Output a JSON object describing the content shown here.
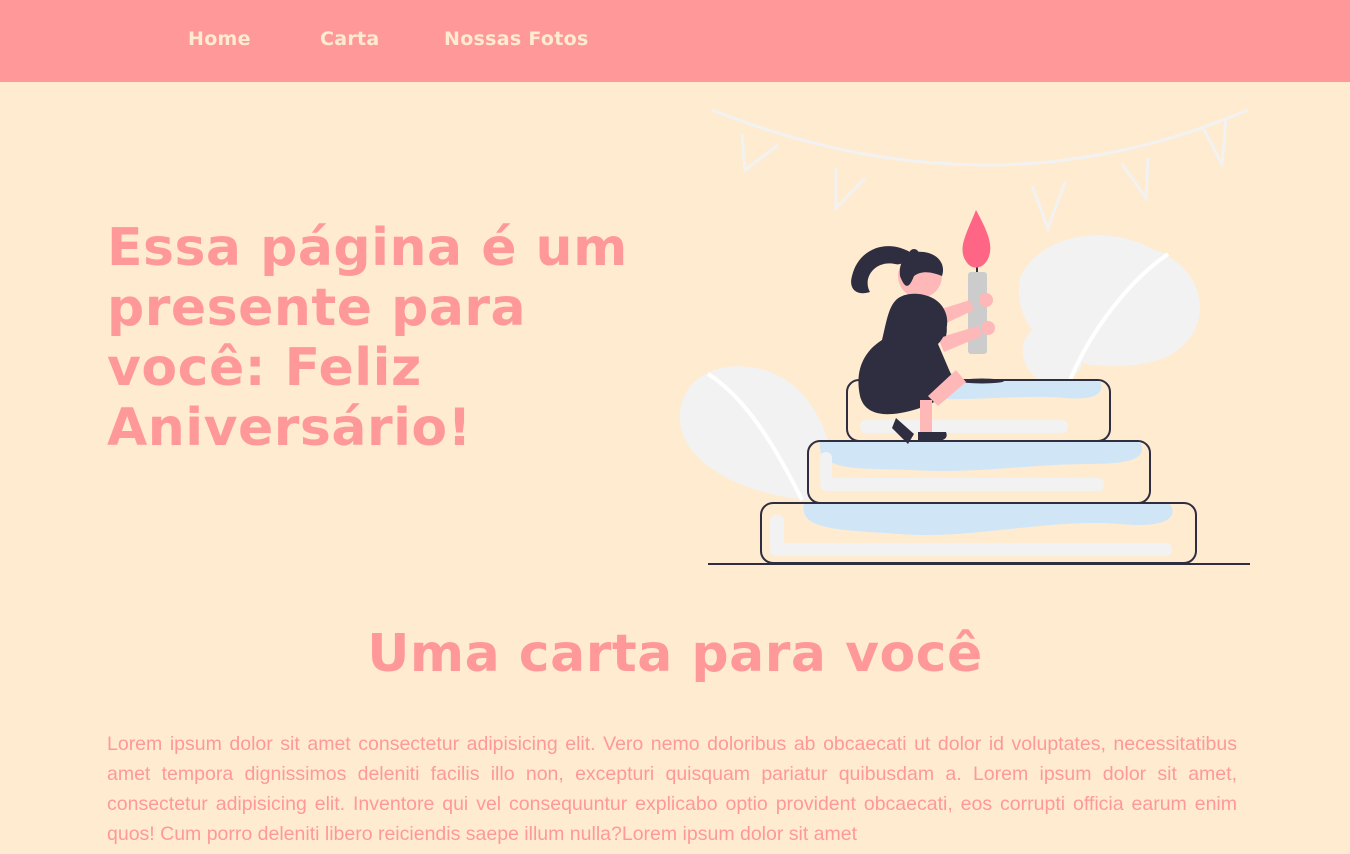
{
  "nav": {
    "home": "Home",
    "carta": "Carta",
    "fotos": "Nossas Fotos"
  },
  "hero": {
    "title": "Essa página é um presente para você: Feliz Aniversário!"
  },
  "letter": {
    "title": "Uma carta para você",
    "body": "Lorem ipsum dolor sit amet consectetur adipisicing elit. Vero nemo doloribus ab obcaecati ut dolor id voluptates, necessitatibus amet tempora dignissimos deleniti facilis illo non, excepturi quisquam pariatur quibusdam a. Lorem ipsum dolor sit amet, consectetur adipisicing elit. Inventore qui vel consequuntur explicabo optio provident obcaecati, eos corrupti officia earum enim quos! Cum porro deleniti libero reiciendis saepe illum nulla?Lorem ipsum dolor sit amet"
  },
  "colors": {
    "background": "#ffebd0",
    "navbar": "#ff9999",
    "accent": "#ff9999",
    "candle_flame": "#ff6584",
    "figure_dark": "#2f2e41",
    "cake_icing": "#d0e6f7",
    "leaf": "#f2f2f2"
  },
  "illustration": {
    "name": "birthday-cake-illustration"
  }
}
